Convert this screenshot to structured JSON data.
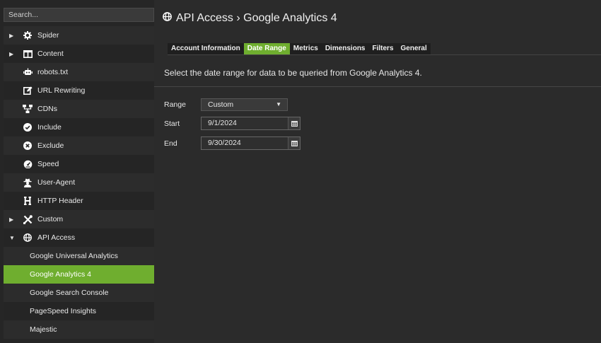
{
  "search": {
    "placeholder": "Search..."
  },
  "sidebar": {
    "items": [
      {
        "label": "Spider",
        "arrow": "▶",
        "icon": "gear-icon"
      },
      {
        "label": "Content",
        "arrow": "▶",
        "icon": "columns-icon"
      },
      {
        "label": "robots.txt",
        "icon": "robot-icon"
      },
      {
        "label": "URL Rewriting",
        "icon": "edit-icon"
      },
      {
        "label": "CDNs",
        "icon": "network-icon"
      },
      {
        "label": "Include",
        "icon": "check-circle-icon"
      },
      {
        "label": "Exclude",
        "icon": "x-circle-icon"
      },
      {
        "label": "Speed",
        "icon": "speedometer-icon"
      },
      {
        "label": "User-Agent",
        "icon": "user-secret-icon"
      },
      {
        "label": "HTTP Header",
        "icon": "header-icon"
      },
      {
        "label": "Custom",
        "arrow": "▶",
        "icon": "tools-icon"
      },
      {
        "label": "API Access",
        "arrow": "▼",
        "icon": "globe-icon"
      },
      {
        "label": "Google Universal Analytics"
      },
      {
        "label": "Google Analytics 4",
        "active": true
      },
      {
        "label": "Google Search Console"
      },
      {
        "label": "PageSpeed Insights"
      },
      {
        "label": "Majestic"
      }
    ]
  },
  "header": {
    "title": "API Access › Google Analytics 4",
    "icon": "globe-icon"
  },
  "tabs": [
    {
      "label": "Account Information"
    },
    {
      "label": "Date Range",
      "active": true
    },
    {
      "label": "Metrics"
    },
    {
      "label": "Dimensions"
    },
    {
      "label": "Filters"
    },
    {
      "label": "General"
    }
  ],
  "main": {
    "description": "Select the date range for data to be queried from Google Analytics 4.",
    "range": {
      "label": "Range",
      "value": "Custom"
    },
    "start": {
      "label": "Start",
      "value": "9/1/2024"
    },
    "end": {
      "label": "End",
      "value": "9/30/2024"
    }
  },
  "colors": {
    "accent": "#6fae2f",
    "background": "#2b2b2b",
    "sidebar": "#262626"
  }
}
